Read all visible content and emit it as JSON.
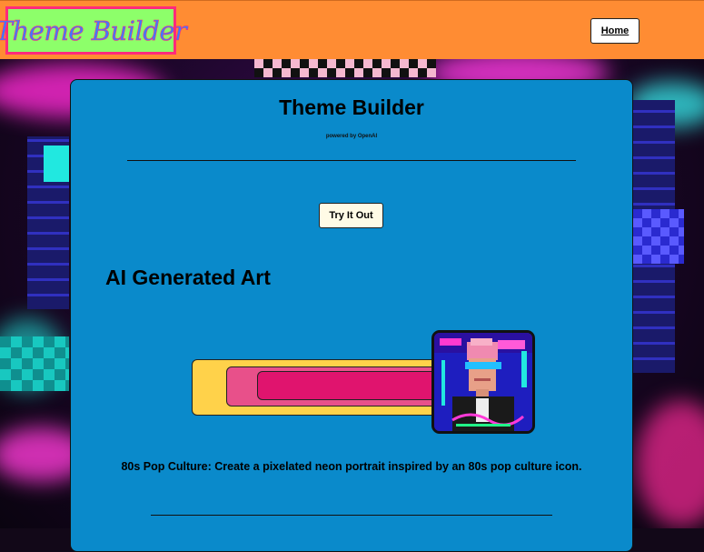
{
  "header": {
    "logo_text": "Theme Builder",
    "home_label": "Home"
  },
  "main": {
    "title": "Theme Builder",
    "powered_by": "powered by OpenAI",
    "try_label": "Try It Out",
    "section_title": "AI Generated Art",
    "caption": "80s Pop Culture: Create a pixelated neon portrait inspired by an 80s pop culture icon."
  },
  "colors": {
    "header_bg": "#ff8c33",
    "logo_bg": "#8dff6a",
    "logo_border": "#ff2a7a",
    "card_bg": "#0a8acb",
    "bar_yellow": "#ffd24a",
    "bar_pink": "#e8508a",
    "bar_magenta": "#e0146e"
  },
  "icons": {
    "portrait": "pixel-neon-portrait-image"
  }
}
